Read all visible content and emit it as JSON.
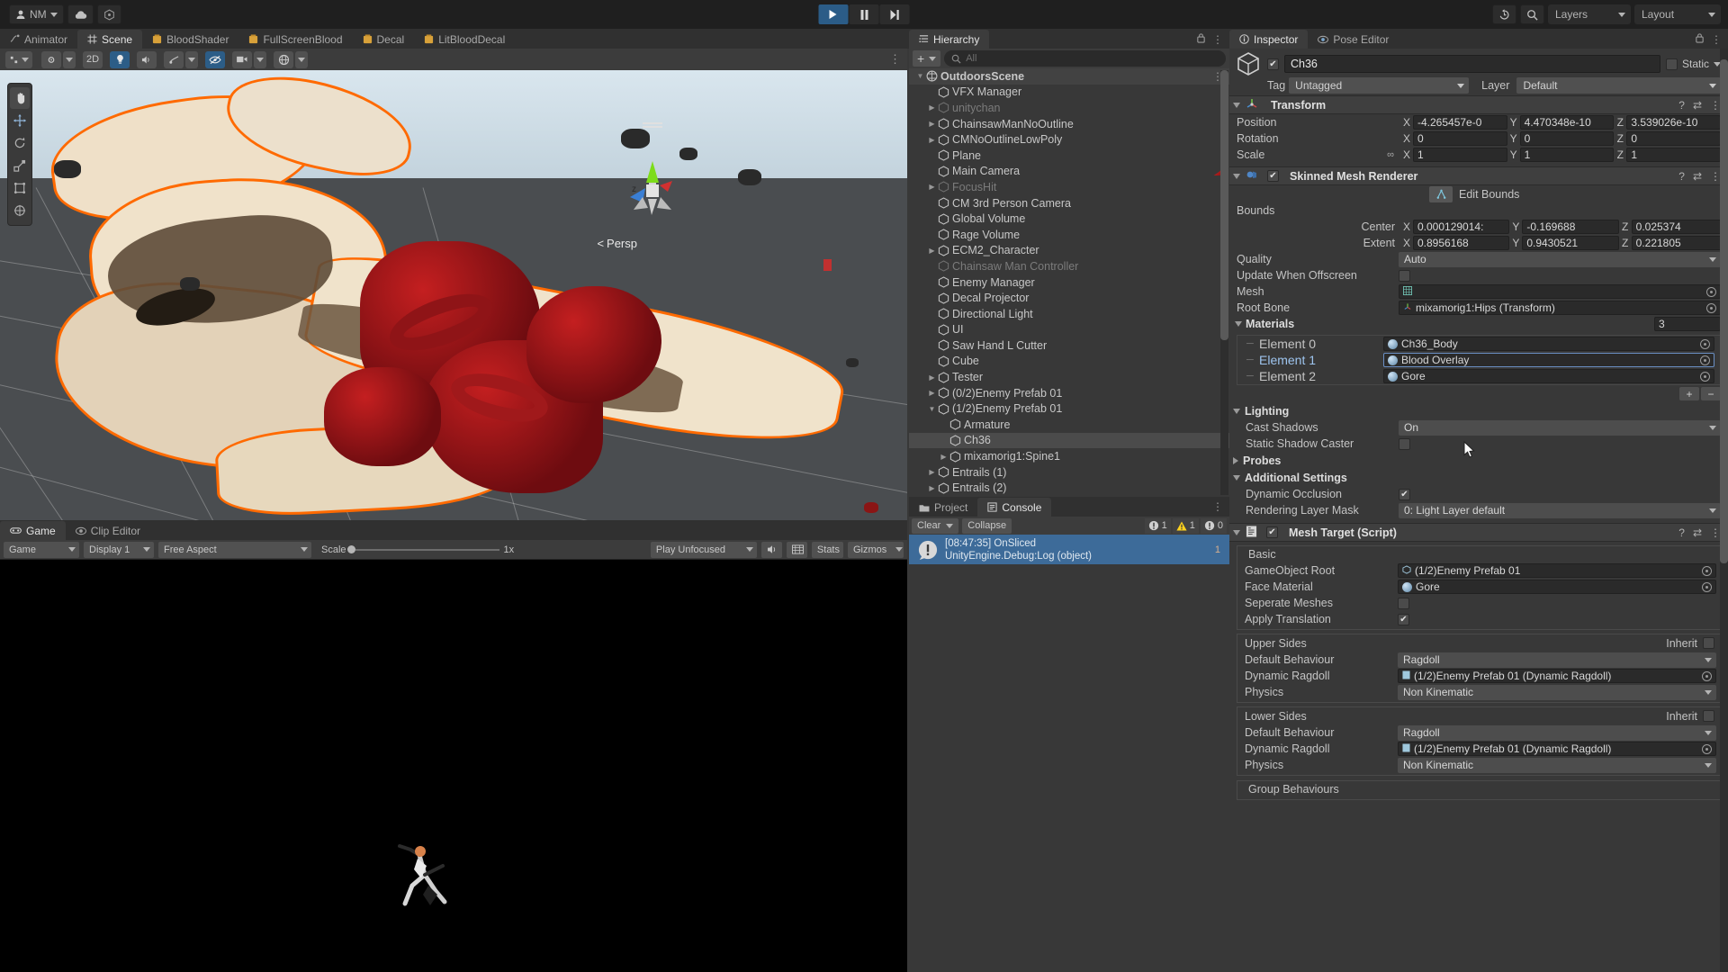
{
  "topbar": {
    "account": "NM",
    "icons": [
      "account-icon",
      "cloud-icon",
      "services-icon"
    ],
    "play": "play-icon",
    "pause": "pause-icon",
    "step": "step-icon",
    "history_icon": "undo-history-icon",
    "search_icon": "search-icon",
    "layers": "Layers",
    "layout": "Layout"
  },
  "tabs": [
    {
      "label": "Animator",
      "icon": "animator-icon",
      "active": false
    },
    {
      "label": "Scene",
      "icon": "scene-grid-icon",
      "active": true
    },
    {
      "label": "BloodShader",
      "icon": "shader-graph-icon",
      "active": false
    },
    {
      "label": "FullScreenBlood",
      "icon": "shader-graph-icon",
      "active": false
    },
    {
      "label": "Decal",
      "icon": "shader-graph-icon",
      "active": false
    },
    {
      "label": "LitBloodDecal",
      "icon": "shader-graph-icon",
      "active": false
    }
  ],
  "scene": {
    "toolbar": {
      "tools": [
        "hand-tool",
        "move-tool",
        "rotate-tool",
        "scale-tool",
        "rect-tool",
        "transform-tool"
      ],
      "pivot": "pivot-icon",
      "handle": "handle-icon",
      "view_2d": "2D",
      "lighting": "lighting-icon",
      "audio": "audio-icon",
      "fx": "fx-icon",
      "visibility": "scene-visibility-icon",
      "camera": "scene-camera-icon",
      "gizmos": "gizmos-icon"
    },
    "persp_label": "Persp",
    "axis_label": "z"
  },
  "game": {
    "tabs": [
      {
        "label": "Game",
        "icon": "game-icon",
        "active": true
      },
      {
        "label": "Clip Editor",
        "icon": "eye-icon",
        "active": false
      }
    ],
    "mode": "Game",
    "display": "Display 1",
    "aspect": "Free Aspect",
    "scale_label": "Scale",
    "scale_value": "1x",
    "play_mode": "Play Unfocused",
    "mute_icon": "audio-icon",
    "stats": "Stats",
    "gizmos": "Gizmos"
  },
  "hierarchy": {
    "tab": "Hierarchy",
    "tab_icon": "hierarchy-icon",
    "add_label": "+",
    "search_placeholder": "All",
    "items": [
      {
        "label": "OutdoorsScene",
        "depth": 0,
        "twisty": "down",
        "icon": "scene-icon",
        "dim": false,
        "scene": true,
        "selected": false,
        "menu": true
      },
      {
        "label": "VFX Manager",
        "depth": 1,
        "twisty": "",
        "icon": "gameobject-icon",
        "dim": false
      },
      {
        "label": "unitychan",
        "depth": 1,
        "twisty": "right",
        "icon": "gameobject-icon",
        "dim": true
      },
      {
        "label": "ChainsawManNoOutline",
        "depth": 1,
        "twisty": "right",
        "icon": "gameobject-icon",
        "dim": false
      },
      {
        "label": "CMNoOutlineLowPoly",
        "depth": 1,
        "twisty": "right",
        "icon": "gameobject-icon",
        "dim": false
      },
      {
        "label": "Plane",
        "depth": 1,
        "twisty": "",
        "icon": "gameobject-icon",
        "dim": false
      },
      {
        "label": "Main Camera",
        "depth": 1,
        "twisty": "",
        "icon": "gameobject-icon",
        "dim": false,
        "badge": true
      },
      {
        "label": "FocusHit",
        "depth": 1,
        "twisty": "right",
        "icon": "gameobject-icon",
        "dim": true
      },
      {
        "label": "CM 3rd Person Camera",
        "depth": 1,
        "twisty": "",
        "icon": "gameobject-icon",
        "dim": false
      },
      {
        "label": "Global Volume",
        "depth": 1,
        "twisty": "",
        "icon": "gameobject-icon",
        "dim": false
      },
      {
        "label": "Rage Volume",
        "depth": 1,
        "twisty": "",
        "icon": "gameobject-icon",
        "dim": false
      },
      {
        "label": "ECM2_Character",
        "depth": 1,
        "twisty": "right",
        "icon": "gameobject-icon",
        "dim": false
      },
      {
        "label": "Chainsaw Man Controller",
        "depth": 1,
        "twisty": "",
        "icon": "gameobject-icon",
        "dim": true
      },
      {
        "label": "Enemy Manager",
        "depth": 1,
        "twisty": "",
        "icon": "gameobject-icon",
        "dim": false
      },
      {
        "label": "Decal Projector",
        "depth": 1,
        "twisty": "",
        "icon": "gameobject-icon",
        "dim": false
      },
      {
        "label": "Directional Light",
        "depth": 1,
        "twisty": "",
        "icon": "gameobject-icon",
        "dim": false
      },
      {
        "label": "UI",
        "depth": 1,
        "twisty": "",
        "icon": "gameobject-icon",
        "dim": false
      },
      {
        "label": "Saw Hand L Cutter",
        "depth": 1,
        "twisty": "",
        "icon": "gameobject-icon",
        "dim": false
      },
      {
        "label": "Cube",
        "depth": 1,
        "twisty": "",
        "icon": "gameobject-icon",
        "dim": false
      },
      {
        "label": "Tester",
        "depth": 1,
        "twisty": "right",
        "icon": "gameobject-icon",
        "dim": false
      },
      {
        "label": "(0/2)Enemy Prefab 01",
        "depth": 1,
        "twisty": "right",
        "icon": "gameobject-icon",
        "dim": false
      },
      {
        "label": "(1/2)Enemy Prefab 01",
        "depth": 1,
        "twisty": "down",
        "icon": "gameobject-icon",
        "dim": false
      },
      {
        "label": "Armature",
        "depth": 2,
        "twisty": "",
        "icon": "gameobject-icon",
        "dim": false
      },
      {
        "label": "Ch36",
        "depth": 2,
        "twisty": "",
        "icon": "gameobject-icon",
        "dim": false,
        "selected": true
      },
      {
        "label": "mixamorig1:Spine1",
        "depth": 2,
        "twisty": "right",
        "icon": "gameobject-icon",
        "dim": false
      },
      {
        "label": "Entrails (1)",
        "depth": 1,
        "twisty": "right",
        "icon": "gameobject-icon",
        "dim": false
      },
      {
        "label": "Entrails (2)",
        "depth": 1,
        "twisty": "right",
        "icon": "gameobject-icon",
        "dim": false
      }
    ]
  },
  "console": {
    "tabs": [
      {
        "label": "Project",
        "icon": "folder-icon",
        "active": false
      },
      {
        "label": "Console",
        "icon": "console-icon",
        "active": true
      }
    ],
    "clear": "Clear",
    "collapse": "Collapse",
    "error_count": "1",
    "warning_count": "1",
    "info_count": "0",
    "entry": {
      "title": "[08:47:35] OnSliced",
      "subtitle": "UnityEngine.Debug:Log (object)",
      "count": "1"
    }
  },
  "inspector": {
    "tabs": [
      {
        "label": "Inspector",
        "icon": "info-icon",
        "active": true
      },
      {
        "label": "Pose Editor",
        "icon": "eye-icon",
        "active": false
      }
    ],
    "lock_icon": "lock-icon",
    "menu_icon": "kebab-menu-icon",
    "object": {
      "enabled": true,
      "name": "Ch36",
      "static_label": "Static",
      "tag_label": "Tag",
      "tag_value": "Untagged",
      "layer_label": "Layer",
      "layer_value": "Default"
    },
    "transform": {
      "title": "Transform",
      "rows": [
        {
          "name": "Position",
          "x": "-4.265457e-0",
          "y": "4.470348e-10",
          "z": "3.539026e-10"
        },
        {
          "name": "Rotation",
          "x": "0",
          "y": "0",
          "z": "0"
        },
        {
          "name": "Scale",
          "x": "1",
          "y": "1",
          "z": "1",
          "link": true
        }
      ]
    },
    "skinned_mesh": {
      "title": "Skinned Mesh Renderer",
      "enabled": true,
      "edit_bounds": "Edit Bounds",
      "bounds_label": "Bounds",
      "center_label": "Center",
      "center": {
        "x": "0.000129014:",
        "y": "-0.169688",
        "z": "0.025374"
      },
      "extent_label": "Extent",
      "extent": {
        "x": "0.8956168",
        "y": "0.9430521",
        "z": "0.221805"
      },
      "quality_label": "Quality",
      "quality_value": "Auto",
      "update_offscreen_label": "Update When Offscreen",
      "update_offscreen": false,
      "mesh_label": "Mesh",
      "mesh_value": "",
      "root_bone_label": "Root Bone",
      "root_bone_value": "mixamorig1:Hips (Transform)",
      "materials_label": "Materials",
      "materials_count": "3",
      "materials": [
        {
          "element": "Element 0",
          "value": "Ch36_Body",
          "highlighted": false
        },
        {
          "element": "Element 1",
          "value": "Blood Overlay",
          "highlighted": true
        },
        {
          "element": "Element 2",
          "value": "Gore",
          "highlighted": false
        }
      ],
      "add_btn": "+",
      "remove_btn": "−",
      "lighting_label": "Lighting",
      "cast_shadows_label": "Cast Shadows",
      "cast_shadows_value": "On",
      "static_shadow_label": "Static Shadow Caster",
      "static_shadow": false,
      "probes_label": "Probes",
      "additional_label": "Additional Settings",
      "dynamic_occlusion_label": "Dynamic Occlusion",
      "dynamic_occlusion": true,
      "render_layer_label": "Rendering Layer Mask",
      "render_layer_value": "0: Light Layer default"
    },
    "mesh_target": {
      "title": "Mesh Target (Script)",
      "enabled": true,
      "basic_label": "Basic",
      "gameobject_root_label": "GameObject Root",
      "gameobject_root_value": "(1/2)Enemy Prefab 01",
      "face_material_label": "Face Material",
      "face_material_value": "Gore",
      "separate_meshes_label": "Seperate Meshes",
      "separate_meshes": false,
      "apply_translation_label": "Apply Translation",
      "apply_translation": true,
      "upper": {
        "title": "Upper Sides",
        "inherit_label": "Inherit",
        "inherit": false,
        "default_behaviour_label": "Default Behaviour",
        "default_behaviour_value": "Ragdoll",
        "dynamic_ragdoll_label": "Dynamic Ragdoll",
        "dynamic_ragdoll_value": "(1/2)Enemy Prefab 01 (Dynamic Ragdoll)",
        "physics_label": "Physics",
        "physics_value": "Non Kinematic"
      },
      "lower": {
        "title": "Lower Sides",
        "inherit_label": "Inherit",
        "inherit": false,
        "default_behaviour_label": "Default Behaviour",
        "default_behaviour_value": "Ragdoll",
        "dynamic_ragdoll_label": "Dynamic Ragdoll",
        "dynamic_ragdoll_value": "(1/2)Enemy Prefab 01 (Dynamic Ragdoll)",
        "physics_label": "Physics",
        "physics_value": "Non Kinematic"
      },
      "group_behaviours_label": "Group Behaviours"
    }
  },
  "colors": {
    "accent_blue": "#3d6b99",
    "selection_blue": "#2c5d87",
    "panel_bg": "#383838",
    "header_bg": "#3f3f3f",
    "outline_orange": "#ff6a00",
    "warning_yellow": "#ffd21e"
  }
}
